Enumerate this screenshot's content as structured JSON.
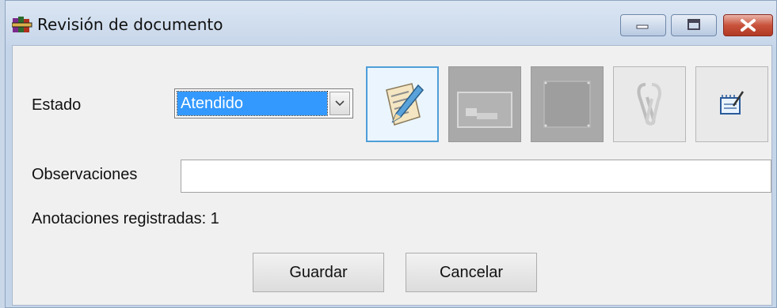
{
  "window": {
    "title": "Revisión de documento",
    "app_icon": "winrar-books-icon",
    "controls": [
      "minimize-icon",
      "maximize-icon",
      "close-icon"
    ]
  },
  "form": {
    "estado_label": "Estado",
    "estado_value": "Atendido",
    "observaciones_label": "Observaciones",
    "observaciones_value": "",
    "annotations_label": "Anotaciones registradas: 1"
  },
  "toolbar": {
    "tools": [
      {
        "icon": "edit-document-icon",
        "state": "active"
      },
      {
        "icon": "scanner-icon",
        "state": "disabled"
      },
      {
        "icon": "blank-frame-icon",
        "state": "disabled"
      },
      {
        "icon": "paperclip-icon",
        "state": "faded"
      },
      {
        "icon": "notepad-pencil-icon",
        "state": "enabled"
      }
    ]
  },
  "buttons": {
    "save": "Guardar",
    "cancel": "Cancelar"
  },
  "colors": {
    "selection": "#3399ff",
    "active_tool_border": "#4f9ed8",
    "close_button": "#c8523c"
  }
}
